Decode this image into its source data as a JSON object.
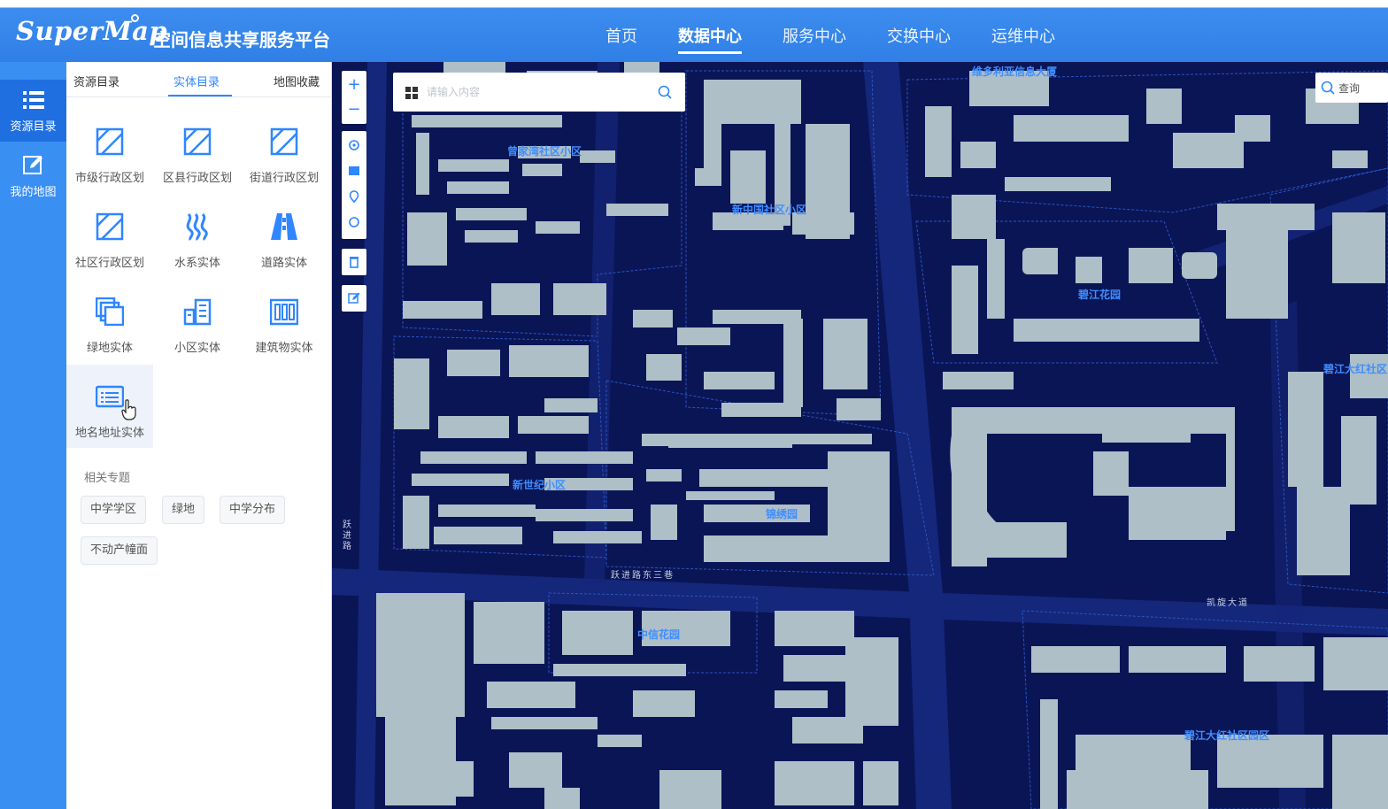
{
  "header": {
    "logo_text": "SuperMap",
    "platform_title": "空间信息共享服务平台",
    "nav": [
      "首页",
      "数据中心",
      "服务中心",
      "交换中心",
      "运维中心"
    ],
    "nav_active_index": 1
  },
  "rail": {
    "items": [
      {
        "label": "资源目录",
        "icon": "list-icon"
      },
      {
        "label": "我的地图",
        "icon": "edit-icon"
      }
    ]
  },
  "panel": {
    "tabs": [
      "资源目录",
      "实体目录",
      "地图收藏"
    ],
    "active_tab_index": 1,
    "entities": [
      {
        "label": "市级行政区划",
        "icon": "boundary-icon"
      },
      {
        "label": "区县行政区划",
        "icon": "boundary-icon"
      },
      {
        "label": "街道行政区划",
        "icon": "boundary-icon"
      },
      {
        "label": "社区行政区划",
        "icon": "boundary-icon"
      },
      {
        "label": "水系实体",
        "icon": "water-icon"
      },
      {
        "label": "道路实体",
        "icon": "road-icon"
      },
      {
        "label": "绿地实体",
        "icon": "layers-icon"
      },
      {
        "label": "小区实体",
        "icon": "residential-icon"
      },
      {
        "label": "建筑物实体",
        "icon": "building-icon"
      },
      {
        "label": "地名地址实体",
        "icon": "address-list-icon"
      }
    ],
    "topics_title": "相关专题",
    "topics": [
      "中学学区",
      "绿地",
      "中学分布",
      "不动产幢面"
    ]
  },
  "map": {
    "search_placeholder": "请输入内容",
    "query_label": "查询",
    "labels": [
      {
        "text": "维多利亚信息大厦"
      },
      {
        "text": "曾家湾社区小区"
      },
      {
        "text": "新中国社区小区"
      },
      {
        "text": "碧江花园"
      },
      {
        "text": "新世纪小区"
      },
      {
        "text": "锦绣园"
      },
      {
        "text": "中信花园"
      },
      {
        "text": "碧江大红社区"
      },
      {
        "text": "碧江大红社区园区"
      }
    ],
    "roads": [
      "跃进路",
      "跃进路东三巷",
      "凯旋大道"
    ],
    "colors": {
      "background": "#0a1556",
      "building": "#aebfc8",
      "road": "#15277a",
      "accent": "#2f86ff"
    }
  }
}
